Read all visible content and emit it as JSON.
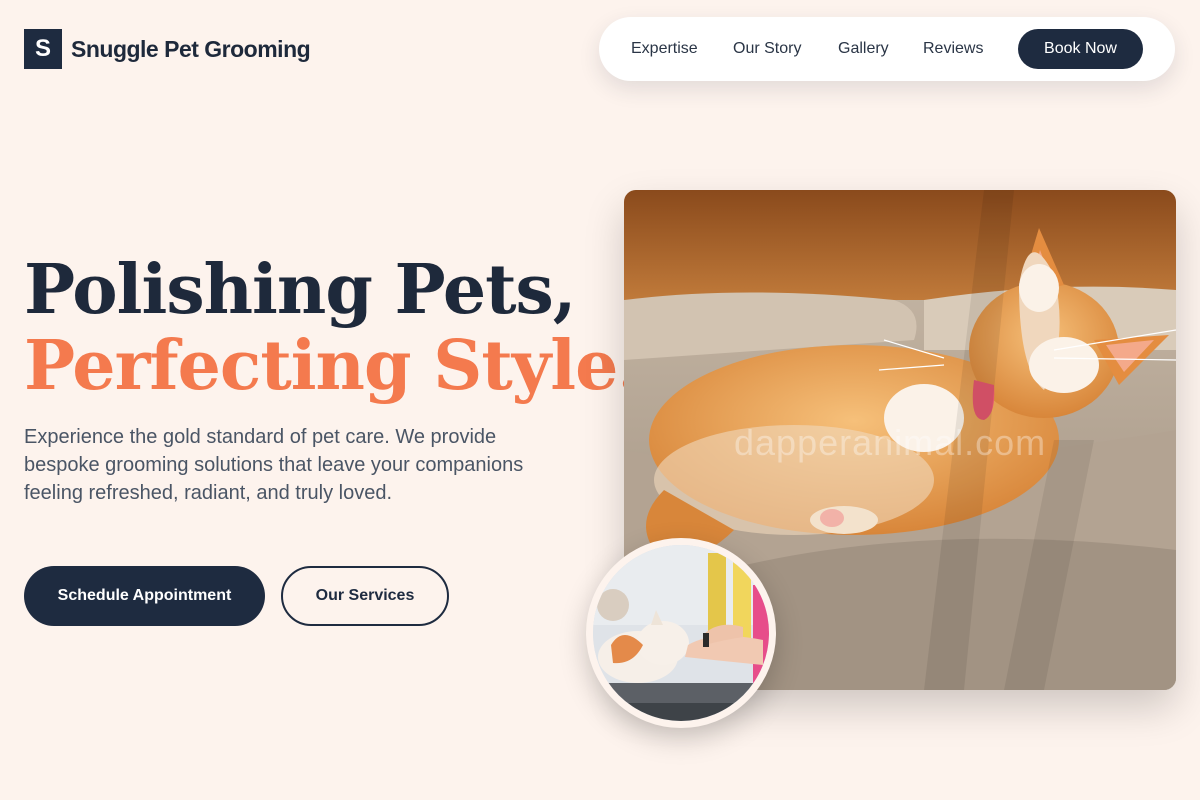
{
  "brand": {
    "mark": "S",
    "name": "Snuggle Pet Grooming"
  },
  "nav": {
    "links": [
      "Expertise",
      "Our Story",
      "Gallery",
      "Reviews"
    ],
    "cta": "Book Now"
  },
  "hero": {
    "title_line1": "Polishing Pets,",
    "title_line2": "Perfecting Style.",
    "description": "Experience the gold standard of pet care. We provide bespoke grooming solutions that leave your companions feeling refreshed, radiant, and truly loved.",
    "primary_cta": "Schedule Appointment",
    "secondary_cta": "Our Services",
    "image_watermark": "dapperanimal.com"
  },
  "colors": {
    "background": "#fdf3ed",
    "navy": "#1e2b40",
    "accent": "#f47a4e"
  }
}
